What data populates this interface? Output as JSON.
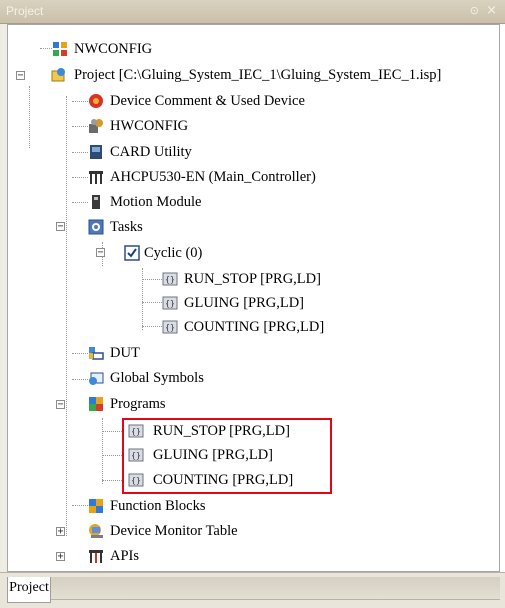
{
  "window": {
    "title": "Project",
    "pin_glyph": "⊙",
    "close_glyph": "×"
  },
  "tree": {
    "nwconfig": {
      "label": "NWCONFIG",
      "icon": "network-config-icon"
    },
    "project": {
      "label": "Project [C:\\Gluing_System_IEC_1\\Gluing_System_IEC_1.isp]",
      "icon": "project-icon",
      "expander": "−"
    },
    "device_comment": {
      "label": "Device Comment & Used Device",
      "icon": "device-comment-icon"
    },
    "hwconfig": {
      "label": "HWCONFIG",
      "icon": "hardware-config-icon"
    },
    "card_utility": {
      "label": "CARD Utility",
      "icon": "card-utility-icon"
    },
    "cpu": {
      "label": "AHCPU530-EN  (Main_Controller)",
      "icon": "cpu-icon"
    },
    "motion": {
      "label": "Motion Module",
      "icon": "motion-module-icon"
    },
    "tasks": {
      "label": "Tasks",
      "icon": "tasks-icon",
      "expander": "−"
    },
    "cyclic": {
      "label": "Cyclic (0)",
      "icon": "checkbox-icon",
      "expander": "−"
    },
    "task_programs": [
      {
        "label": "RUN_STOP [PRG,LD]"
      },
      {
        "label": "GLUING [PRG,LD]"
      },
      {
        "label": "COUNTING [PRG,LD]"
      }
    ],
    "dut": {
      "label": "DUT",
      "icon": "dut-icon"
    },
    "global_symbols": {
      "label": "Global Symbols",
      "icon": "global-symbols-icon"
    },
    "programs": {
      "label": "Programs",
      "icon": "programs-icon",
      "expander": "−"
    },
    "program_items": [
      {
        "label": "RUN_STOP [PRG,LD]"
      },
      {
        "label": "GLUING [PRG,LD]"
      },
      {
        "label": "COUNTING [PRG,LD]"
      }
    ],
    "function_blocks": {
      "label": "Function Blocks",
      "icon": "function-blocks-icon"
    },
    "device_monitor": {
      "label": "Device Monitor Table",
      "icon": "device-monitor-icon",
      "expander": "+"
    },
    "apis": {
      "label": "APIs",
      "icon": "apis-icon",
      "expander": "+"
    }
  },
  "tabs": [
    {
      "label": "Project",
      "active": true
    }
  ],
  "colors": {
    "highlight": "#e30613",
    "title_bar": "#d1cab4"
  }
}
